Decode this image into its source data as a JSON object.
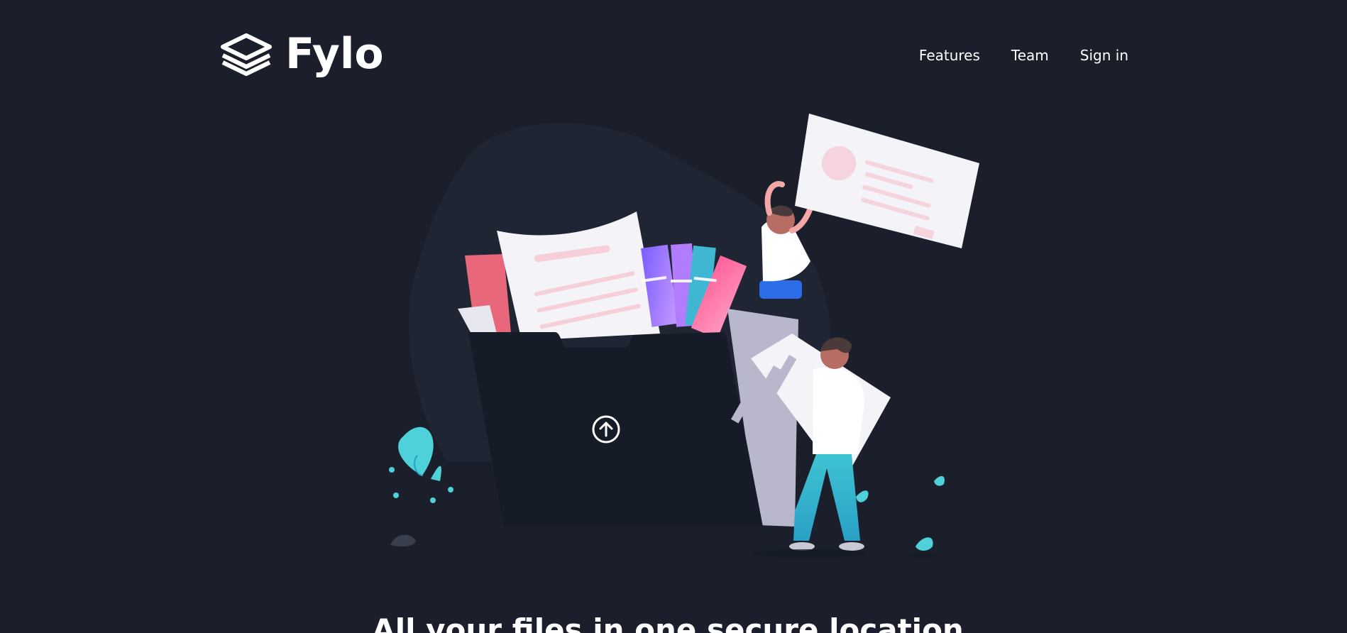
{
  "brand": {
    "name": "Fylo",
    "logo_icon": "stacked-layers-icon"
  },
  "nav": {
    "items": [
      {
        "label": "Features"
      },
      {
        "label": "Team"
      },
      {
        "label": "Sign in"
      }
    ]
  },
  "hero": {
    "headline": "All your files in one secure location,",
    "upload_icon": "arrow-up-circle-icon"
  },
  "colors": {
    "background": "#1b1f2b",
    "text": "#ffffff",
    "accent_cyan": "#4fd1d9",
    "accent_pink": "#f7a8b8",
    "accent_purple": "#8a6cff",
    "folder": "#151b27"
  }
}
